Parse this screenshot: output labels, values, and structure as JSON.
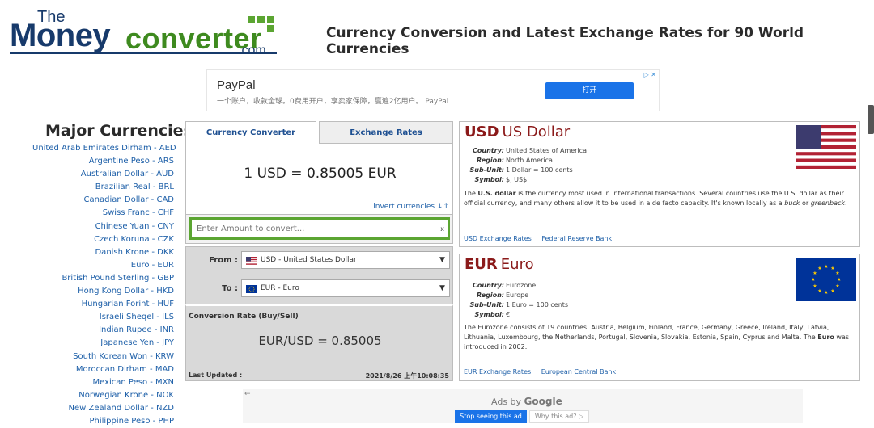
{
  "header": {
    "logo_the": "The",
    "logo_money": "Money",
    "logo_converter": "converter",
    "logo_com": ".com",
    "site_title": "Currency Conversion and Latest Exchange Rates for 90 World Currencies"
  },
  "top_ad": {
    "brand": "PayPal",
    "text": "一个账户，收款全球。0费用开户，享卖家保障，赢遍2亿用户。 PayPal",
    "button": "打开",
    "choices": "ᵈ ✕"
  },
  "major": {
    "title": "Major Currencies",
    "items": [
      "United Arab Emirates Dirham - AED",
      "Argentine Peso - ARS",
      "Australian Dollar - AUD",
      "Brazilian Real - BRL",
      "Canadian Dollar - CAD",
      "Swiss Franc - CHF",
      "Chinese Yuan - CNY",
      "Czech Koruna - CZK",
      "Danish Krone - DKK",
      "Euro - EUR",
      "British Pound Sterling - GBP",
      "Hong Kong Dollar - HKD",
      "Hungarian Forint - HUF",
      "Israeli Sheqel - ILS",
      "Indian Rupee - INR",
      "Japanese Yen - JPY",
      "South Korean Won - KRW",
      "Moroccan Dirham - MAD",
      "Mexican Peso - MXN",
      "Norwegian Krone - NOK",
      "New Zealand Dollar - NZD",
      "Philippine Peso - PHP"
    ]
  },
  "converter": {
    "tab_converter": "Currency Converter",
    "tab_rates": "Exchange Rates",
    "rate_display": "1 USD = 0.85005 EUR",
    "invert_label": "invert currencies ↓↑",
    "amount_placeholder": "Enter Amount to convert...",
    "amount_clear": "x",
    "from_label": "From :",
    "from_value": "USD - United States Dollar",
    "to_label": "To :",
    "to_value": "EUR - Euro",
    "caret": "▼",
    "conv_rate_label": "Conversion Rate (Buy/Sell)",
    "conv_rate_value": "EUR/USD = 0.85005",
    "last_updated_label": "Last Updated :",
    "last_updated_value": "2021/8/26 上午10:08:35"
  },
  "usd": {
    "code": "USD",
    "name": "US Dollar",
    "country_k": "Country:",
    "country_v": "United States of America",
    "region_k": "Region:",
    "region_v": "North America",
    "subunit_k": "Sub-Unit:",
    "subunit_v": "1 Dollar = 100 cents",
    "symbol_k": "Symbol:",
    "symbol_v": "$, US$",
    "desc_1": "The ",
    "desc_b1": "U.S. dollar",
    "desc_2": " is the currency most used in international transactions. Several countries use the U.S. dollar as their official currency, and many others allow it to be used in a de facto capacity. It's known locally as a ",
    "desc_i1": "buck",
    "desc_3": " or ",
    "desc_i2": "greenback",
    "desc_4": ".",
    "link1": "USD Exchange Rates",
    "link2": "Federal Reserve Bank"
  },
  "eur": {
    "code": "EUR",
    "name": "Euro",
    "country_k": "Country:",
    "country_v": "Eurozone",
    "region_k": "Region:",
    "region_v": "Europe",
    "subunit_k": "Sub-Unit:",
    "subunit_v": "1 Euro = 100 cents",
    "symbol_k": "Symbol:",
    "symbol_v": "€",
    "desc_1": "The Eurozone consists of 19 countries: Austria, Belgium, Finland, France, Germany, Greece, Ireland, Italy, Latvia, Lithuania, Luxembourg, the Netherlands, Portugal, Slovenia, Slovakia, Estonia, Spain, Cyprus and Malta. The ",
    "desc_b1": "Euro",
    "desc_2": " was introduced in 2002.",
    "link1": "EUR Exchange Rates",
    "link2": "European Central Bank"
  },
  "bottom_ad": {
    "back": "←",
    "ads_by": "Ads by ",
    "google": "Google",
    "stop": "Stop seeing this ad",
    "why": "Why this ad? ▷"
  },
  "colors": {
    "brand_blue": "#173a6b",
    "brand_green": "#3e8a1f",
    "currency_red": "#8b1a1a",
    "link_blue": "#1d5fa8",
    "input_border": "#5ba532"
  }
}
